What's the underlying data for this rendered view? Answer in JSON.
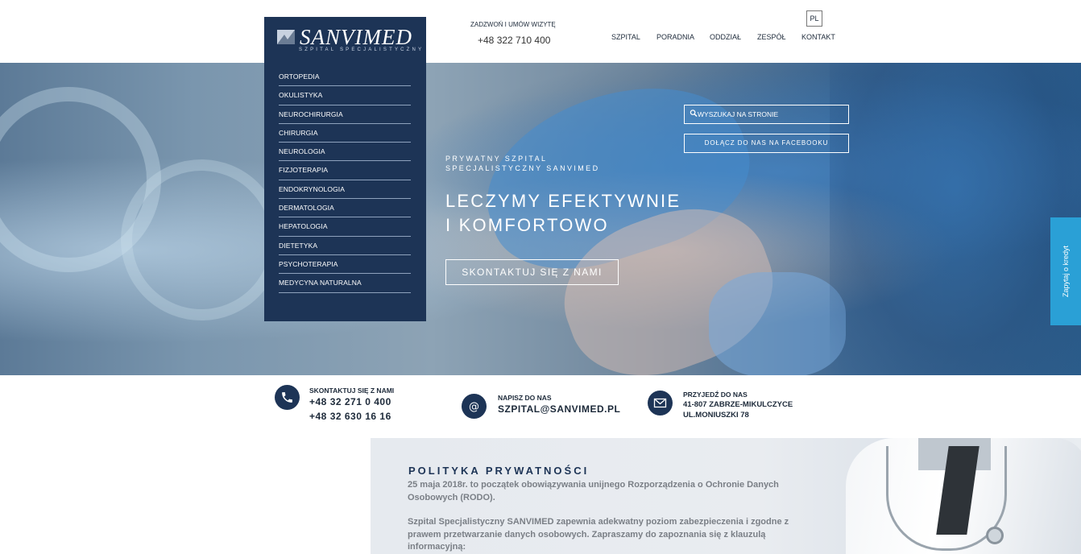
{
  "header": {
    "logo": {
      "text": "SANVIMED",
      "subtitle": "SZPITAL SPECJALISTYCZNY"
    },
    "call": {
      "label": "ZADZWOŃ I UMÓW WIZYTĘ",
      "phone": "+48 322 710 400"
    },
    "nav": [
      "SZPITAL",
      "PORADNIA",
      "ODDZIAŁ",
      "ZESPÓŁ",
      "KONTAKT"
    ],
    "lang": "PL"
  },
  "sidebar": {
    "items": [
      "ORTOPEDIA",
      "OKULISTYKA",
      "NEUROCHIRURGIA",
      "CHIRURGIA",
      "NEUROLOGIA",
      "FIZJOTERAPIA",
      "ENDOKRYNOLOGIA",
      "DERMATOLOGIA",
      "HEPATOLOGIA",
      "DIETETYKA",
      "PSYCHOTERAPIA",
      "MEDYCYNA NATURALNA"
    ]
  },
  "hero": {
    "pre_line1": "PRYWATNY SZPITAL",
    "pre_line2": "SPECJALISTYCZNY SANVIMED",
    "title_line1": "LECZYMY EFEKTYWNIE",
    "title_line2": "I KOMFORTOWO",
    "cta": "SKONTAKTUJ SIĘ Z NAMI",
    "search_placeholder": "WYSZUKAJ NA STRONIE",
    "facebook": "DOŁĄCZ DO NAS NA FACEBOOKU",
    "credit_tab": "Zapytaj o kredyt"
  },
  "contact": {
    "phone": {
      "label": "SKONTAKTUJ SIĘ Z NAMI",
      "line1": "+48 32 271 0 400",
      "line2": "+48 32 630 16 16"
    },
    "email": {
      "label": "NAPISZ DO NAS",
      "value": "SZPITAL@SANVIMED.PL"
    },
    "address": {
      "label": "PRZYJEDŹ DO NAS",
      "line1": "41-807 ZABRZE-MIKULCZYCE",
      "line2": "UL.MONIUSZKI 78"
    }
  },
  "privacy": {
    "title": "POLITYKA PRYWATNOŚCI",
    "p1": "25 maja 2018r. to początek obowiązywania unijnego Rozporządzenia o Ochronie Danych Osobowych (RODO).",
    "p2": "Szpital Specjalistyczny SANVIMED zapewnia adekwatny poziom zabezpieczenia i zgodne z prawem przetwarzanie danych osobowych. Zapraszamy do zapoznania się z klauzulą informacyjną:"
  },
  "colors": {
    "navy": "#1d3456",
    "accent_blue": "#2aa0d6"
  }
}
